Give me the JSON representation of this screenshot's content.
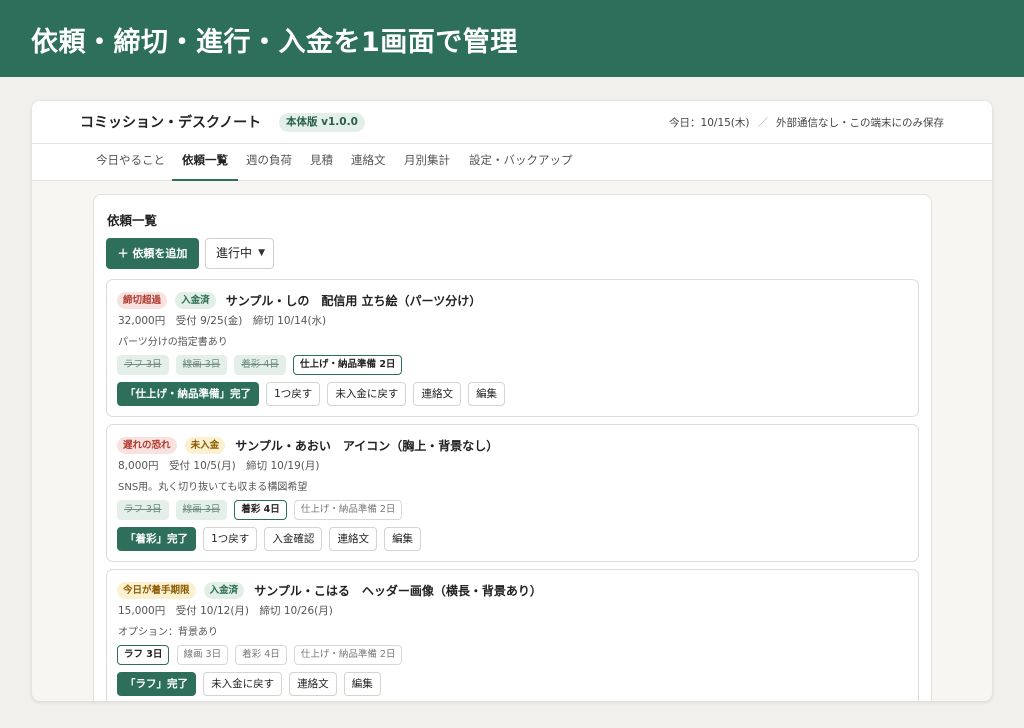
{
  "banner": {
    "title": "依頼・締切・進行・入金を1画面で管理"
  },
  "header": {
    "app_title": "コミッション・デスクノート",
    "version": "本体版 v1.0.0",
    "today": "今日：10/15(木)",
    "separator": "／",
    "storage_note": "外部通信なし・この端末にのみ保存"
  },
  "tabs": [
    {
      "label": "今日やること"
    },
    {
      "label": "依頼一覧"
    },
    {
      "label": "週の負荷"
    },
    {
      "label": "見積"
    },
    {
      "label": "連絡文"
    },
    {
      "label": "月別集計"
    },
    {
      "label": "設定・バックアップ"
    }
  ],
  "active_tab": "依頼一覧",
  "panel": {
    "title": "依頼一覧",
    "add_button": "＋ 依頼を追加",
    "filter_value": "進行中"
  },
  "cards": [
    {
      "badges": [
        {
          "text": "締切超過",
          "tone": "red"
        },
        {
          "text": "入金済",
          "tone": "green"
        }
      ],
      "title": "サンプル・しの　配信用 立ち絵（パーツ分け）",
      "meta": "32,000円　受付 9/25(金)　締切 10/14(水)",
      "note": "パーツ分けの指定書あり",
      "stages": [
        {
          "label": "ラフ 3日",
          "state": "done"
        },
        {
          "label": "線画 3日",
          "state": "done"
        },
        {
          "label": "着彩 4日",
          "state": "done"
        },
        {
          "label": "仕上げ・納品準備 2日",
          "state": "current"
        }
      ],
      "actions": [
        "「仕上げ・納品準備」完了",
        "1つ戻す",
        "未入金に戻す",
        "連絡文",
        "編集"
      ]
    },
    {
      "badges": [
        {
          "text": "遅れの恐れ",
          "tone": "red"
        },
        {
          "text": "未入金",
          "tone": "yellow"
        }
      ],
      "title": "サンプル・あおい　アイコン（胸上・背景なし）",
      "meta": "8,000円　受付 10/5(月)　締切 10/19(月)",
      "note": "SNS用。丸く切り抜いても収まる構図希望",
      "stages": [
        {
          "label": "ラフ 3日",
          "state": "done"
        },
        {
          "label": "線画 3日",
          "state": "done"
        },
        {
          "label": "着彩 4日",
          "state": "current"
        },
        {
          "label": "仕上げ・納品準備 2日",
          "state": "todo"
        }
      ],
      "actions": [
        "「着彩」完了",
        "1つ戻す",
        "入金確認",
        "連絡文",
        "編集"
      ]
    },
    {
      "badges": [
        {
          "text": "今日が着手期限",
          "tone": "yellow"
        },
        {
          "text": "入金済",
          "tone": "green"
        }
      ],
      "title": "サンプル・こはる　ヘッダー画像（横長・背景あり）",
      "meta": "15,000円　受付 10/12(月)　締切 10/26(月)",
      "note": "オプション：背景あり",
      "stages": [
        {
          "label": "ラフ 3日",
          "state": "current"
        },
        {
          "label": "線画 3日",
          "state": "todo"
        },
        {
          "label": "着彩 4日",
          "state": "todo"
        },
        {
          "label": "仕上げ・納品準備 2日",
          "state": "todo"
        }
      ],
      "actions": [
        "「ラフ」完了",
        "未入金に戻す",
        "連絡文",
        "編集"
      ]
    }
  ]
}
